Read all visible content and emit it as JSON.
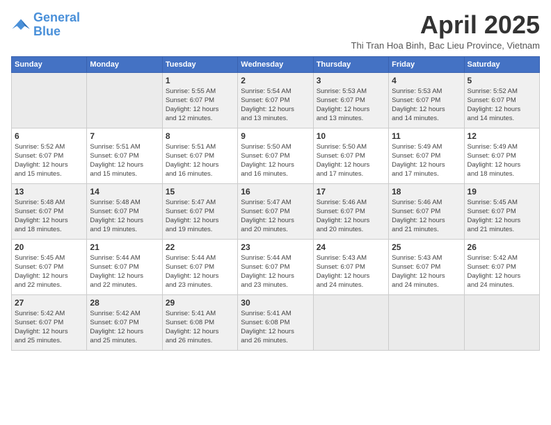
{
  "logo": {
    "line1": "General",
    "line2": "Blue"
  },
  "title": "April 2025",
  "subtitle": "Thi Tran Hoa Binh, Bac Lieu Province, Vietnam",
  "weekdays": [
    "Sunday",
    "Monday",
    "Tuesday",
    "Wednesday",
    "Thursday",
    "Friday",
    "Saturday"
  ],
  "weeks": [
    [
      {
        "day": "",
        "info": ""
      },
      {
        "day": "",
        "info": ""
      },
      {
        "day": "1",
        "info": "Sunrise: 5:55 AM\nSunset: 6:07 PM\nDaylight: 12 hours\nand 12 minutes."
      },
      {
        "day": "2",
        "info": "Sunrise: 5:54 AM\nSunset: 6:07 PM\nDaylight: 12 hours\nand 13 minutes."
      },
      {
        "day": "3",
        "info": "Sunrise: 5:53 AM\nSunset: 6:07 PM\nDaylight: 12 hours\nand 13 minutes."
      },
      {
        "day": "4",
        "info": "Sunrise: 5:53 AM\nSunset: 6:07 PM\nDaylight: 12 hours\nand 14 minutes."
      },
      {
        "day": "5",
        "info": "Sunrise: 5:52 AM\nSunset: 6:07 PM\nDaylight: 12 hours\nand 14 minutes."
      }
    ],
    [
      {
        "day": "6",
        "info": "Sunrise: 5:52 AM\nSunset: 6:07 PM\nDaylight: 12 hours\nand 15 minutes."
      },
      {
        "day": "7",
        "info": "Sunrise: 5:51 AM\nSunset: 6:07 PM\nDaylight: 12 hours\nand 15 minutes."
      },
      {
        "day": "8",
        "info": "Sunrise: 5:51 AM\nSunset: 6:07 PM\nDaylight: 12 hours\nand 16 minutes."
      },
      {
        "day": "9",
        "info": "Sunrise: 5:50 AM\nSunset: 6:07 PM\nDaylight: 12 hours\nand 16 minutes."
      },
      {
        "day": "10",
        "info": "Sunrise: 5:50 AM\nSunset: 6:07 PM\nDaylight: 12 hours\nand 17 minutes."
      },
      {
        "day": "11",
        "info": "Sunrise: 5:49 AM\nSunset: 6:07 PM\nDaylight: 12 hours\nand 17 minutes."
      },
      {
        "day": "12",
        "info": "Sunrise: 5:49 AM\nSunset: 6:07 PM\nDaylight: 12 hours\nand 18 minutes."
      }
    ],
    [
      {
        "day": "13",
        "info": "Sunrise: 5:48 AM\nSunset: 6:07 PM\nDaylight: 12 hours\nand 18 minutes."
      },
      {
        "day": "14",
        "info": "Sunrise: 5:48 AM\nSunset: 6:07 PM\nDaylight: 12 hours\nand 19 minutes."
      },
      {
        "day": "15",
        "info": "Sunrise: 5:47 AM\nSunset: 6:07 PM\nDaylight: 12 hours\nand 19 minutes."
      },
      {
        "day": "16",
        "info": "Sunrise: 5:47 AM\nSunset: 6:07 PM\nDaylight: 12 hours\nand 20 minutes."
      },
      {
        "day": "17",
        "info": "Sunrise: 5:46 AM\nSunset: 6:07 PM\nDaylight: 12 hours\nand 20 minutes."
      },
      {
        "day": "18",
        "info": "Sunrise: 5:46 AM\nSunset: 6:07 PM\nDaylight: 12 hours\nand 21 minutes."
      },
      {
        "day": "19",
        "info": "Sunrise: 5:45 AM\nSunset: 6:07 PM\nDaylight: 12 hours\nand 21 minutes."
      }
    ],
    [
      {
        "day": "20",
        "info": "Sunrise: 5:45 AM\nSunset: 6:07 PM\nDaylight: 12 hours\nand 22 minutes."
      },
      {
        "day": "21",
        "info": "Sunrise: 5:44 AM\nSunset: 6:07 PM\nDaylight: 12 hours\nand 22 minutes."
      },
      {
        "day": "22",
        "info": "Sunrise: 5:44 AM\nSunset: 6:07 PM\nDaylight: 12 hours\nand 23 minutes."
      },
      {
        "day": "23",
        "info": "Sunrise: 5:44 AM\nSunset: 6:07 PM\nDaylight: 12 hours\nand 23 minutes."
      },
      {
        "day": "24",
        "info": "Sunrise: 5:43 AM\nSunset: 6:07 PM\nDaylight: 12 hours\nand 24 minutes."
      },
      {
        "day": "25",
        "info": "Sunrise: 5:43 AM\nSunset: 6:07 PM\nDaylight: 12 hours\nand 24 minutes."
      },
      {
        "day": "26",
        "info": "Sunrise: 5:42 AM\nSunset: 6:07 PM\nDaylight: 12 hours\nand 24 minutes."
      }
    ],
    [
      {
        "day": "27",
        "info": "Sunrise: 5:42 AM\nSunset: 6:07 PM\nDaylight: 12 hours\nand 25 minutes."
      },
      {
        "day": "28",
        "info": "Sunrise: 5:42 AM\nSunset: 6:07 PM\nDaylight: 12 hours\nand 25 minutes."
      },
      {
        "day": "29",
        "info": "Sunrise: 5:41 AM\nSunset: 6:08 PM\nDaylight: 12 hours\nand 26 minutes."
      },
      {
        "day": "30",
        "info": "Sunrise: 5:41 AM\nSunset: 6:08 PM\nDaylight: 12 hours\nand 26 minutes."
      },
      {
        "day": "",
        "info": ""
      },
      {
        "day": "",
        "info": ""
      },
      {
        "day": "",
        "info": ""
      }
    ]
  ]
}
